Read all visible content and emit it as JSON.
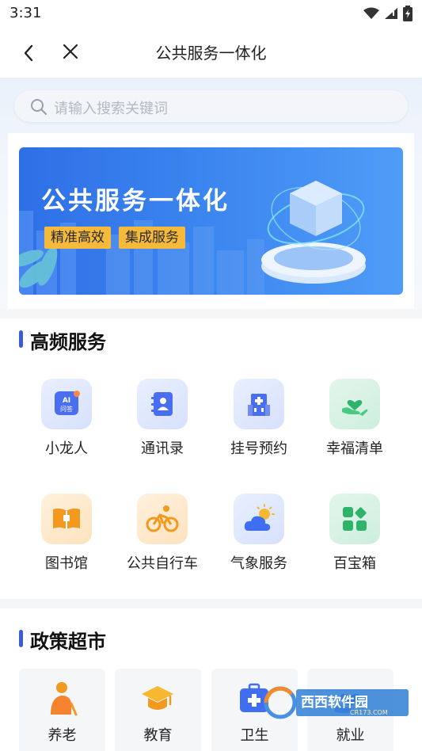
{
  "status": {
    "time": "3:31"
  },
  "nav": {
    "title": "公共服务一体化"
  },
  "search": {
    "placeholder": "请输入搜索关键词"
  },
  "banner": {
    "title": "公共服务一体化",
    "tags": [
      "精准高效",
      "集成服务"
    ]
  },
  "high_freq": {
    "title": "高频服务",
    "items": [
      {
        "label": "小龙人",
        "icon": "ai-qa-icon"
      },
      {
        "label": "通讯录",
        "icon": "contacts-icon"
      },
      {
        "label": "挂号预约",
        "icon": "hospital-icon"
      },
      {
        "label": "幸福清单",
        "icon": "heart-hand-icon"
      },
      {
        "label": "图书馆",
        "icon": "book-icon"
      },
      {
        "label": "公共自行车",
        "icon": "bicycle-icon"
      },
      {
        "label": "气象服务",
        "icon": "weather-icon"
      },
      {
        "label": "百宝箱",
        "icon": "grid-box-icon"
      }
    ],
    "ai_icon_text": [
      "AI",
      "问答"
    ]
  },
  "policy": {
    "title": "政策超市",
    "items": [
      {
        "label": "养老",
        "icon": "elderly-icon"
      },
      {
        "label": "教育",
        "icon": "graduation-cap-icon"
      },
      {
        "label": "卫生",
        "icon": "medical-kit-icon"
      },
      {
        "label": "就业",
        "icon": "care-hand-icon"
      }
    ]
  },
  "watermark": {
    "text": "西西软件园",
    "sub": "CR173.COM"
  },
  "colors": {
    "accent": "#3b5bdb",
    "banner": "#3a84ef",
    "tag": "#f5b93c"
  }
}
